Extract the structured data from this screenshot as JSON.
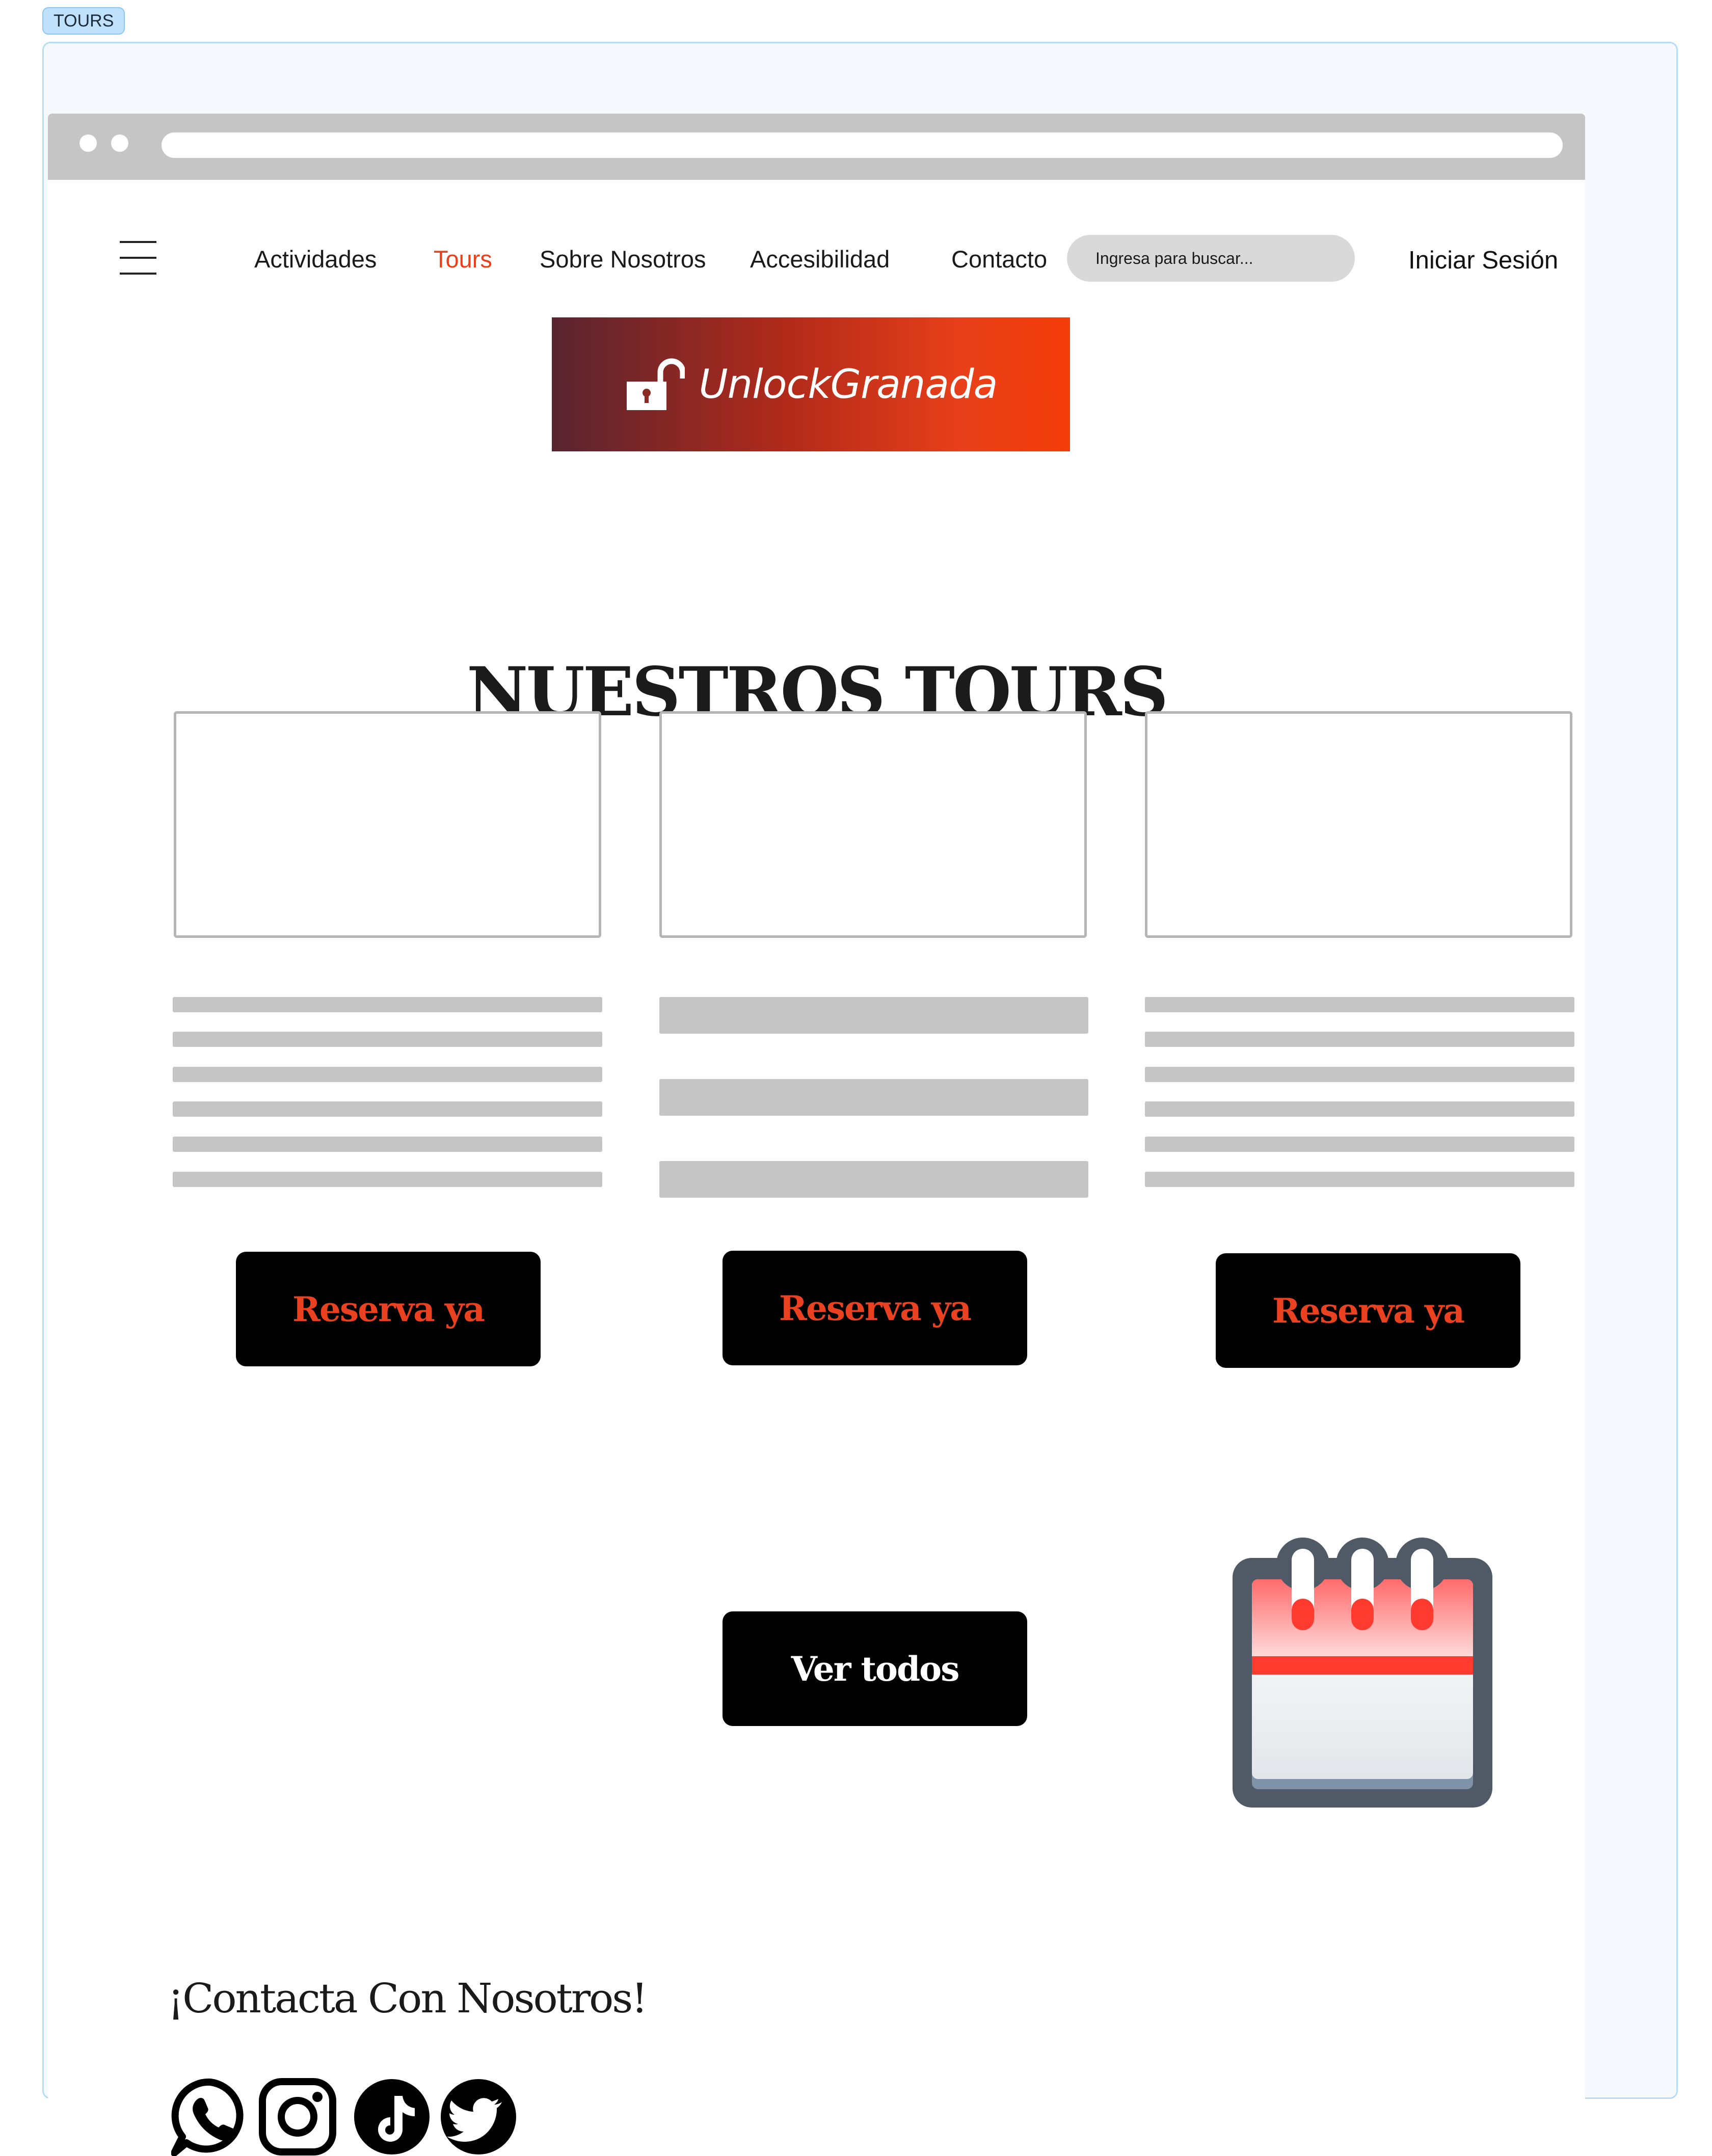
{
  "frame": {
    "label": "TOURS"
  },
  "nav": {
    "items": [
      {
        "label": "Actividades",
        "active": false
      },
      {
        "label": "Tours",
        "active": true
      },
      {
        "label": "Sobre Nosotros",
        "active": false
      },
      {
        "label": "Accesibilidad",
        "active": false
      },
      {
        "label": "Contacto",
        "active": false
      }
    ],
    "search_placeholder": "Ingresa para buscar...",
    "login_label": "Iniciar Sesión"
  },
  "logo": {
    "text": "UnlockGranada",
    "icon": "open-padlock-icon"
  },
  "main": {
    "title": "NUESTROS TOURS",
    "cards": [
      {
        "button_label": "Reserva ya"
      },
      {
        "button_label": "Reserva ya"
      },
      {
        "button_label": "Reserva ya"
      }
    ],
    "view_all_label": "Ver todos",
    "calendar_icon": "calendar-icon"
  },
  "contact": {
    "title": "¡Contacta Con Nosotros!",
    "socials": [
      "whatsapp-icon",
      "instagram-icon",
      "tiktok-icon",
      "twitter-icon"
    ]
  },
  "colors": {
    "accent": "#e8401a",
    "button_bg": "#000000",
    "placeholder_gray": "#c5c5c5",
    "frame_border": "#b7dcf7"
  }
}
